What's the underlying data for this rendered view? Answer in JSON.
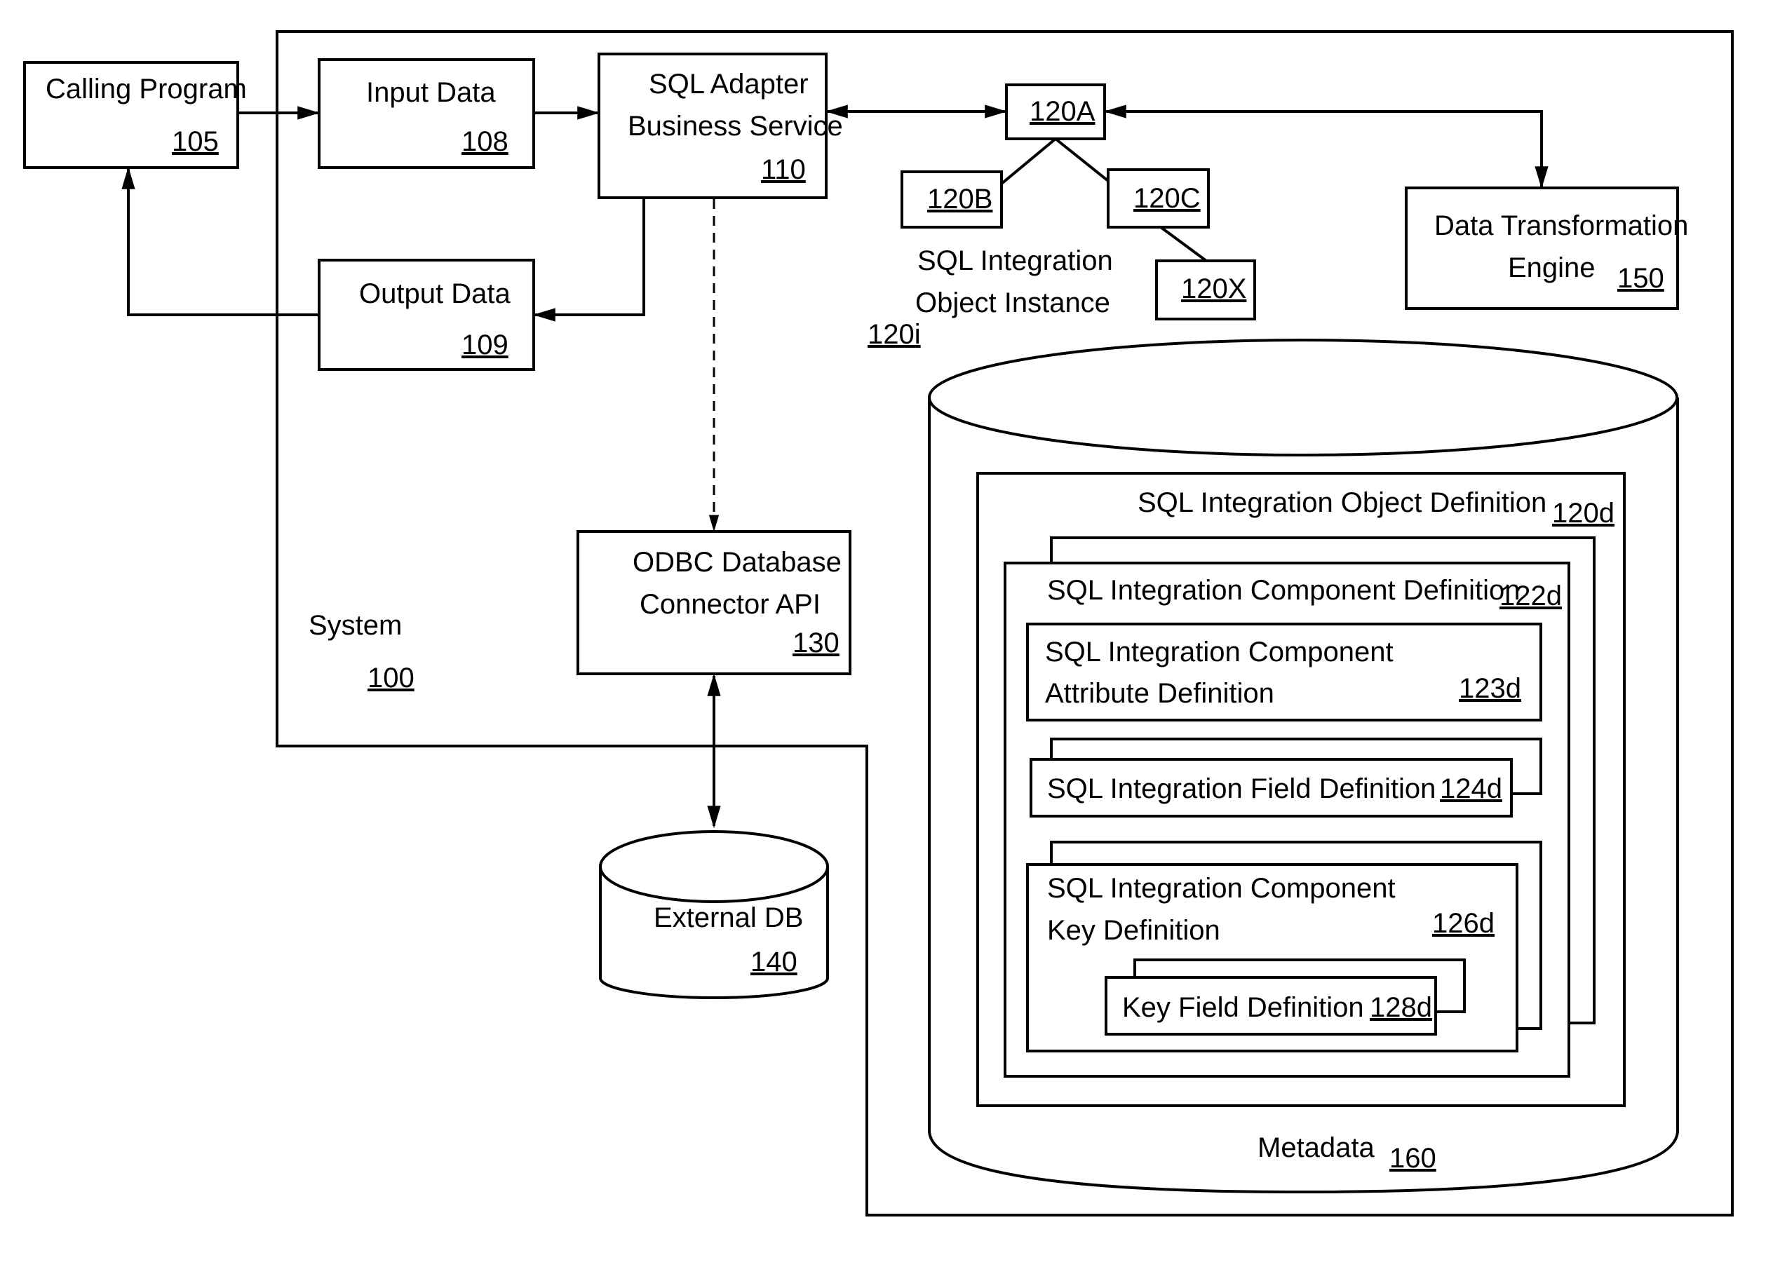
{
  "diagram": {
    "system": {
      "label": "System",
      "ref": "100"
    },
    "calling_program": {
      "label": "Calling Program",
      "ref": "105"
    },
    "input_data": {
      "label": "Input Data",
      "ref": "108"
    },
    "output_data": {
      "label": "Output Data",
      "ref": "109"
    },
    "sql_adapter": {
      "line1": "SQL Adapter",
      "line2": "Business Service",
      "ref": "110"
    },
    "instance": {
      "nodes": {
        "a": "120A",
        "b": "120B",
        "c": "120C",
        "x": "120X"
      },
      "line1": "SQL Integration",
      "line2": "Object Instance",
      "ref": "120i"
    },
    "dte": {
      "line1": "Data Transformation",
      "line2": "Engine",
      "ref": "150"
    },
    "odbc": {
      "line1": "ODBC Database",
      "line2": "Connector API",
      "ref": "130"
    },
    "external_db": {
      "label": "External DB",
      "ref": "140"
    },
    "metadata": {
      "label": "Metadata",
      "ref": "160",
      "object_def": {
        "label": "SQL Integration Object Definition",
        "ref": "120d"
      },
      "component_def": {
        "label": "SQL Integration Component Definition",
        "ref": "122d"
      },
      "attribute_def": {
        "line1": "SQL Integration Component",
        "line2": "Attribute Definition",
        "ref": "123d"
      },
      "field_def": {
        "label": "SQL Integration Field Definition",
        "ref": "124d"
      },
      "key_def": {
        "line1": "SQL Integration Component",
        "line2": "Key Definition",
        "ref": "126d"
      },
      "key_field_def": {
        "label": "Key Field Definition",
        "ref": "128d"
      }
    }
  }
}
